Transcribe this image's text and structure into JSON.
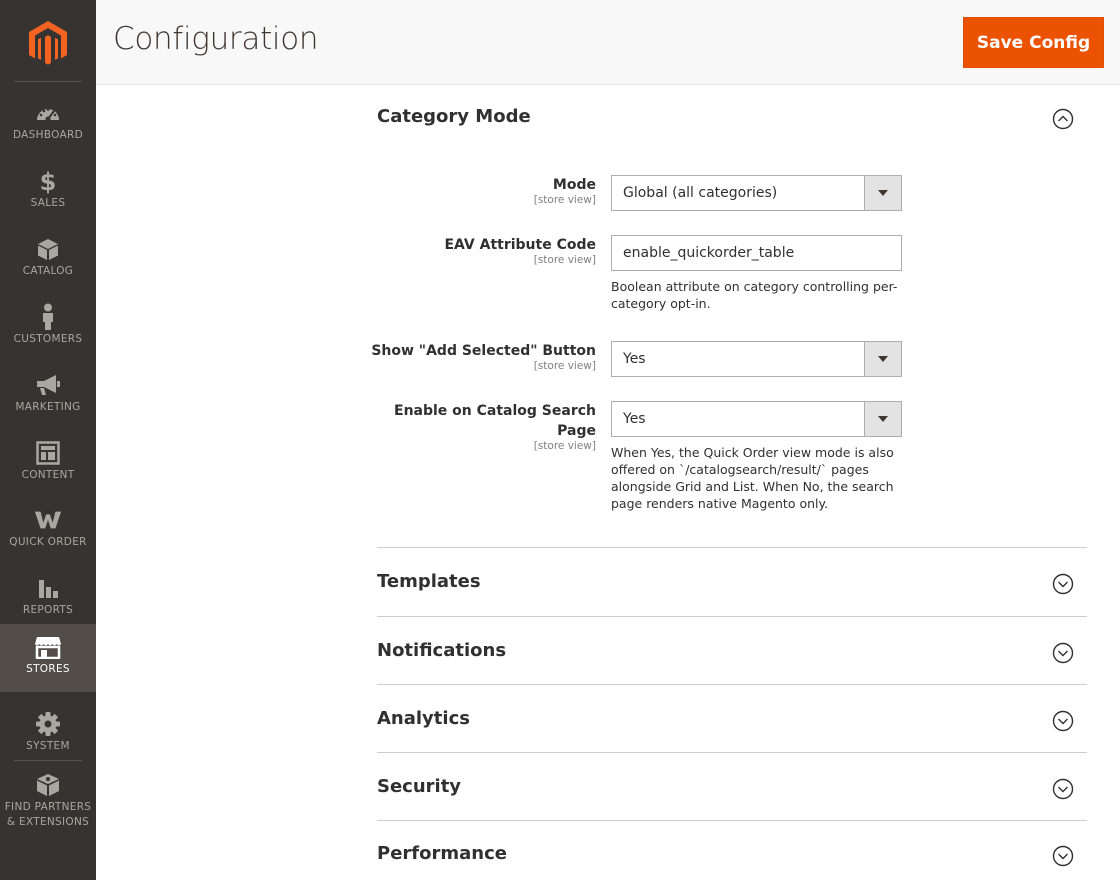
{
  "header": {
    "title": "Configuration",
    "save_label": "Save Config"
  },
  "sidebar": {
    "items": [
      {
        "label": "DASHBOARD",
        "icon": "dashboard-icon"
      },
      {
        "label": "SALES",
        "icon": "dollar-icon"
      },
      {
        "label": "CATALOG",
        "icon": "box-icon"
      },
      {
        "label": "CUSTOMERS",
        "icon": "person-icon"
      },
      {
        "label": "MARKETING",
        "icon": "megaphone-icon"
      },
      {
        "label": "CONTENT",
        "icon": "layout-icon"
      },
      {
        "label": "QUICK ORDER",
        "icon": "quick-order-icon"
      },
      {
        "label": "REPORTS",
        "icon": "bar-chart-icon"
      },
      {
        "label": "STORES",
        "icon": "storefront-icon"
      },
      {
        "label": "SYSTEM",
        "icon": "gear-icon"
      },
      {
        "label_line1": "FIND PARTNERS",
        "label_line2": "& EXTENSIONS",
        "icon": "extensions-icon"
      }
    ],
    "active": "STORES"
  },
  "category_mode": {
    "title": "Category Mode",
    "fields": {
      "mode": {
        "label": "Mode",
        "scope": "[store view]",
        "value": "Global (all categories)"
      },
      "eav": {
        "label": "EAV Attribute Code",
        "scope": "[store view]",
        "value": "enable_quickorder_table",
        "note_line1": "Boolean attribute on category controlling per-",
        "note_line2": "category opt-in."
      },
      "show_add": {
        "label": "Show \"Add Selected\" Button",
        "scope": "[store view]",
        "value": "Yes"
      },
      "search": {
        "label_line1": "Enable on Catalog Search",
        "label_line2": "Page",
        "scope": "[store view]",
        "value": "Yes",
        "note_line1": "When Yes, the Quick Order view mode is also",
        "note_line2": "offered on `/catalogsearch/result/` pages",
        "note_line3": "alongside Grid and List. When No, the search",
        "note_line4": "page renders native Magento only."
      }
    }
  },
  "sections": [
    {
      "title": "Templates"
    },
    {
      "title": "Notifications"
    },
    {
      "title": "Analytics"
    },
    {
      "title": "Security"
    },
    {
      "title": "Performance"
    }
  ],
  "colors": {
    "accent": "#eb5202",
    "sidebar_bg": "#373330",
    "sidebar_active": "#524d49"
  }
}
